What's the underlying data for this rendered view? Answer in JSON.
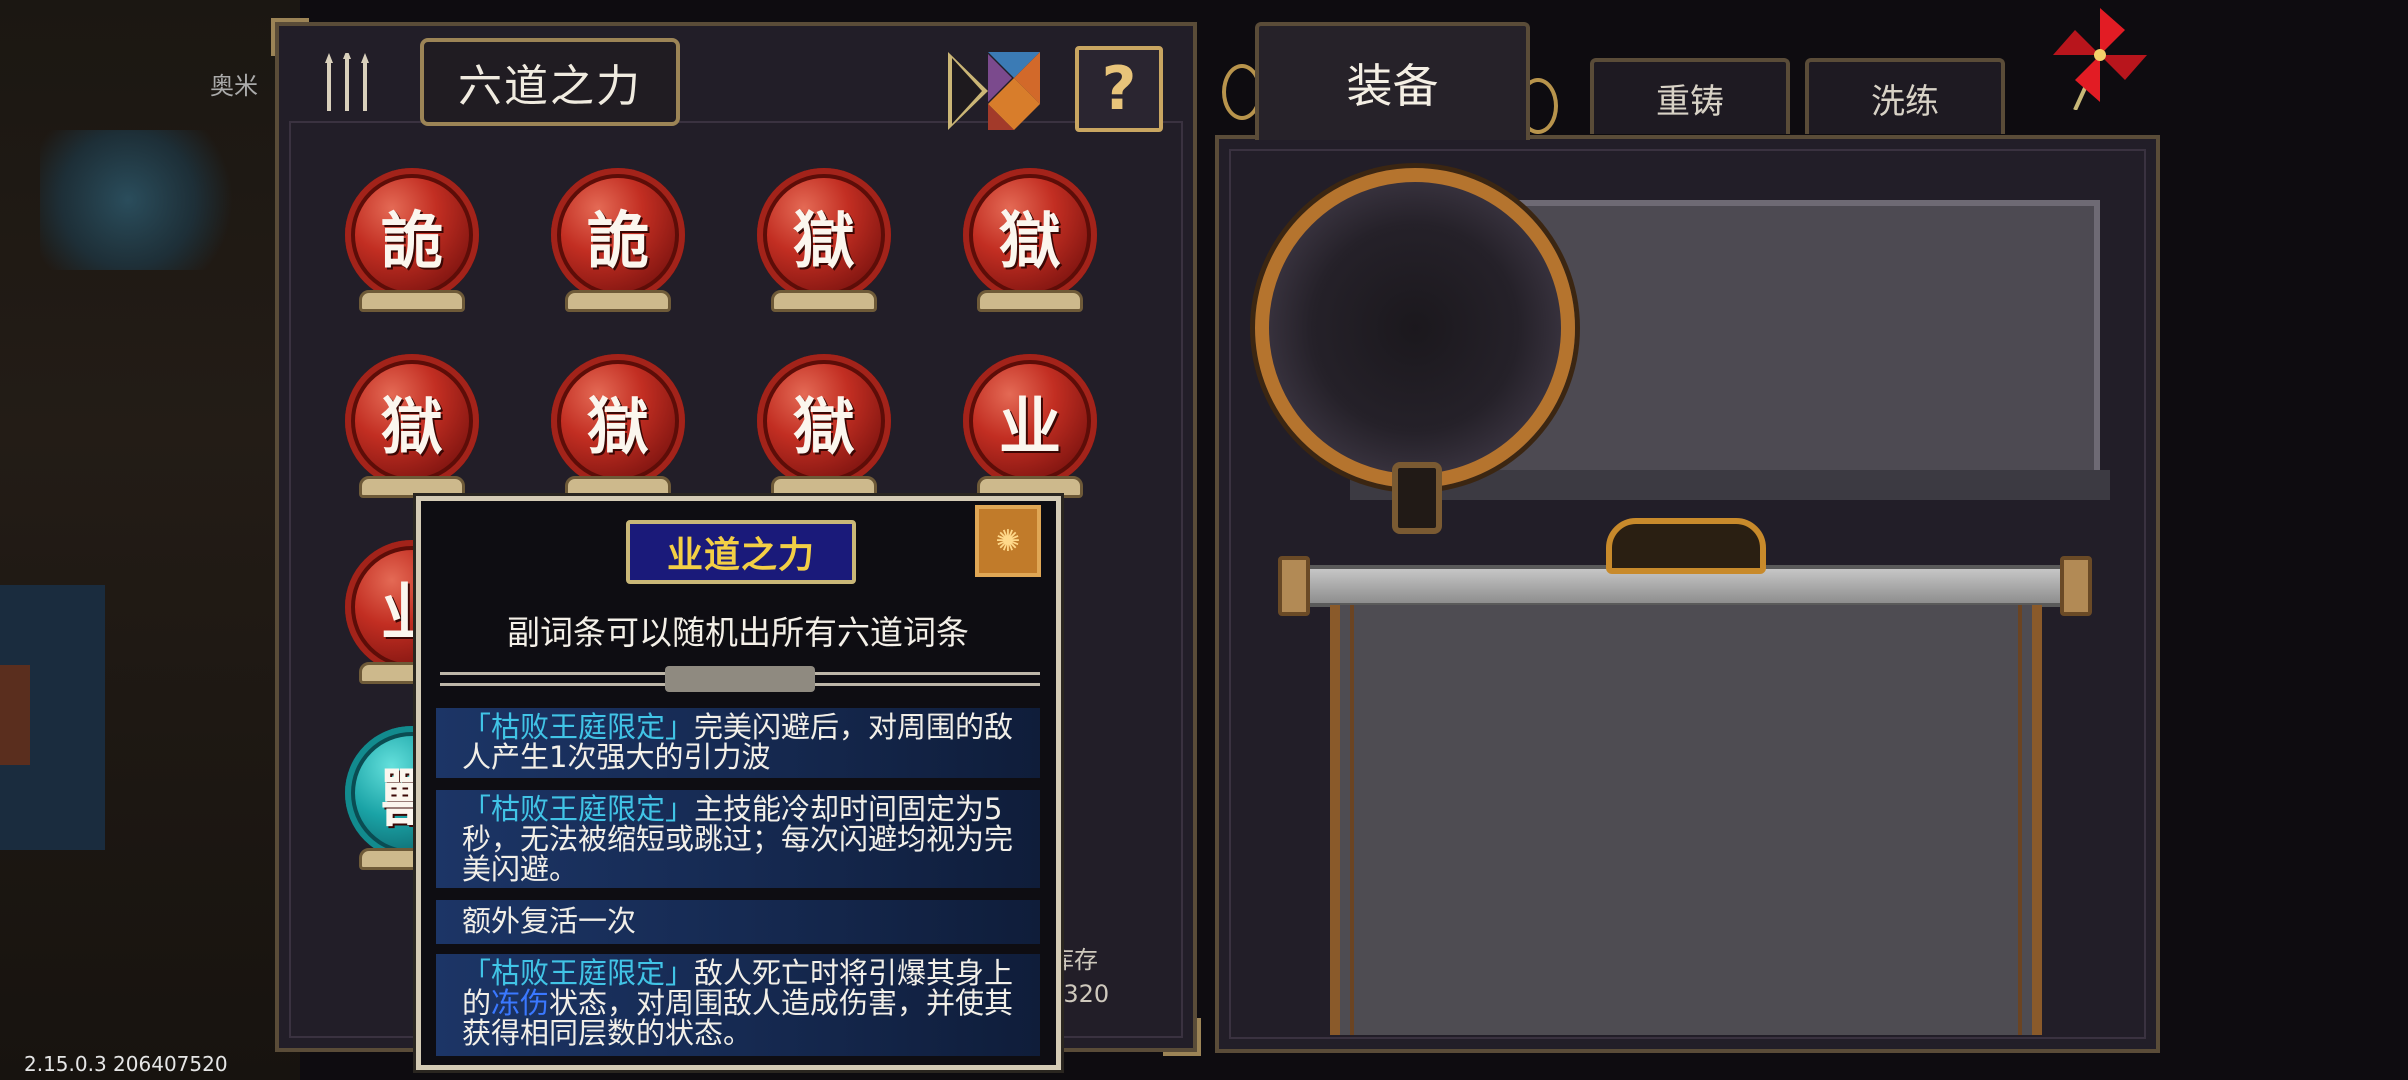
{
  "hud": {
    "player_name": "奥米",
    "version": "2.15.0.3 206407520"
  },
  "left_panel": {
    "title": "六道之力",
    "help_label": "?",
    "stock_label": "库存",
    "stock_count": "1/320",
    "orbs": [
      {
        "glyph": "詭",
        "color": "red"
      },
      {
        "glyph": "詭",
        "color": "red"
      },
      {
        "glyph": "獄",
        "color": "red"
      },
      {
        "glyph": "獄",
        "color": "red"
      },
      {
        "glyph": "獄",
        "color": "red"
      },
      {
        "glyph": "獄",
        "color": "red"
      },
      {
        "glyph": "獄",
        "color": "red"
      },
      {
        "glyph": "业",
        "color": "red"
      },
      {
        "glyph": "业",
        "color": "red"
      },
      {
        "glyph": "獸",
        "color": "teal"
      }
    ]
  },
  "tabs": {
    "equip": "装备",
    "recast": "重铸",
    "refine": "洗练"
  },
  "tooltip": {
    "title": "业道之力",
    "description": "副词条可以随机出所有六道词条",
    "entries": [
      {
        "tag": "「枯败王庭限定」",
        "text_a": "完美闪避后，对周围的敌人产生1次强大的引力波",
        "highlight": "",
        "text_b": ""
      },
      {
        "tag": "「枯败王庭限定」",
        "text_a": "主技能冷却时间固定为5秒，无法被缩短或跳过；每次闪避均视为完美闪避。",
        "highlight": "",
        "text_b": ""
      },
      {
        "tag": "",
        "text_a": "额外复活一次",
        "highlight": "",
        "text_b": ""
      },
      {
        "tag": "「枯败王庭限定」",
        "text_a": "敌人死亡时将引爆其身上的",
        "highlight": "冻伤",
        "text_b": "状态，对周围敌人造成伤害，并使其获得相同层数的状态。"
      }
    ]
  },
  "colors": {
    "panel_bg": "#221e28",
    "panel_border": "#5a4c38",
    "gold": "#c9a661",
    "tag_cyan": "#41c4e6",
    "highlight_blue": "#3a78ff",
    "title_yellow": "#f3cf45"
  }
}
